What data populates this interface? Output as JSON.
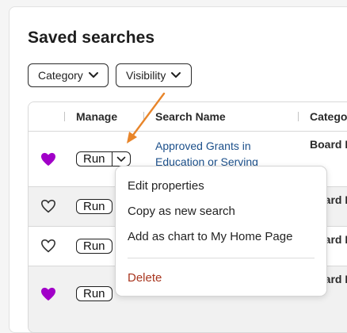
{
  "page": {
    "title": "Saved searches"
  },
  "filters": [
    {
      "label": "Category"
    },
    {
      "label": "Visibility"
    }
  ],
  "table": {
    "columns": [
      "Manage",
      "Search Name",
      "Catego"
    ],
    "rows": [
      {
        "favorite": true,
        "run_label": "Run",
        "search_name": "Approved Grants in Education or Serving",
        "category": "Board M"
      },
      {
        "favorite": false,
        "run_label": "Run",
        "search_name": "",
        "category": "Board M"
      },
      {
        "favorite": false,
        "run_label": "Run",
        "search_name": "",
        "category": "Board M"
      },
      {
        "favorite": true,
        "run_label": "Run",
        "search_name": "",
        "category": "Board M"
      }
    ]
  },
  "menu": {
    "items": [
      "Edit properties",
      "Copy as new search",
      "Add as chart to My Home Page"
    ],
    "danger_item": "Delete"
  },
  "colors": {
    "heart_filled": "#a100c8",
    "link": "#1b4f8a",
    "danger": "#a8361f",
    "annotation_arrow": "#e8852a"
  },
  "icons": {
    "favorite": "heart-icon",
    "dropdown": "chevron-down-icon"
  }
}
